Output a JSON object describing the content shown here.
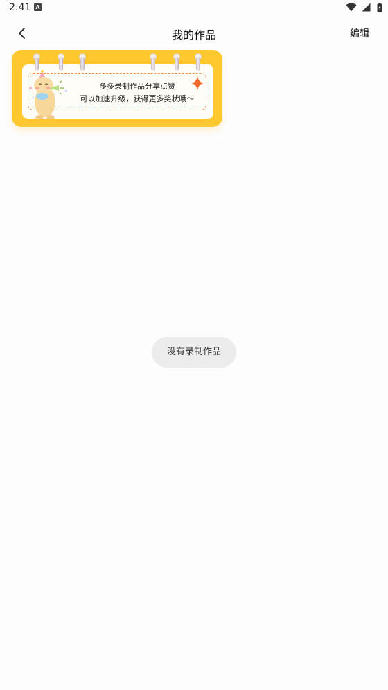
{
  "status_bar": {
    "time": "2:41",
    "notification_icon": "a-letter-icon",
    "icons": [
      "wifi-icon",
      "signal-icon",
      "battery-charging-icon"
    ]
  },
  "header": {
    "back_icon": "chevron-left-icon",
    "title": "我的作品",
    "edit_label": "编辑"
  },
  "banner": {
    "line1": "多多录制作品分享点赞",
    "line2": "可以加速升级，获得更多奖状哦～",
    "colors": {
      "frame": "#ffc82e",
      "dash": "#f28a3c",
      "sparkle": "#f26a2e"
    },
    "illustration": "cartoon-mascot-with-party-horn"
  },
  "empty_state": {
    "message": "没有录制作品"
  }
}
